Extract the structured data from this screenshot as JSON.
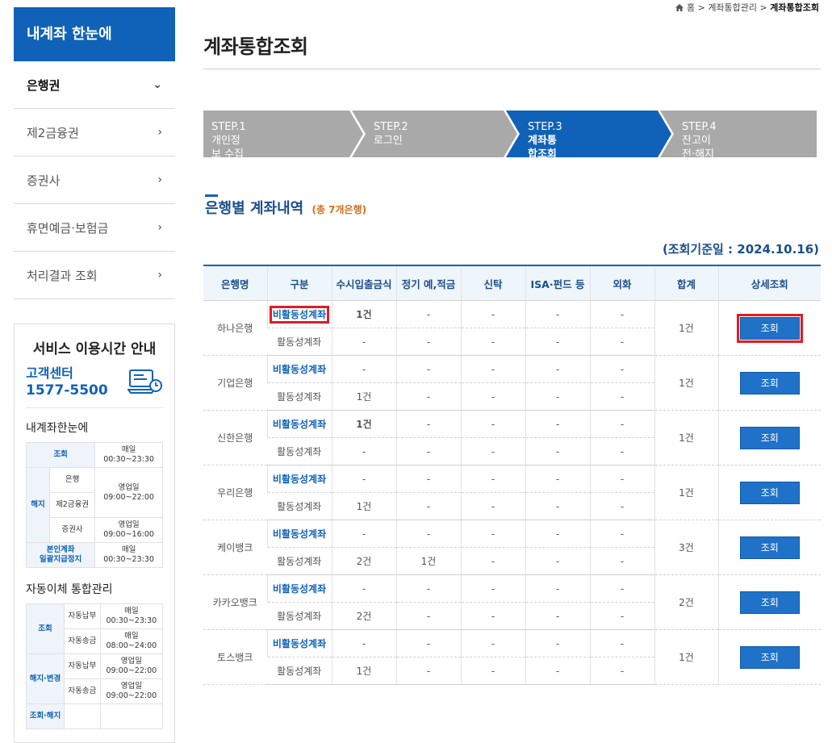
{
  "sidebar": {
    "header": "내계좌 한눈에",
    "items": [
      {
        "label": "은행권",
        "chevron": "⌄"
      },
      {
        "label": "제2금융권",
        "chevron": "›"
      },
      {
        "label": "증권사",
        "chevron": "›"
      },
      {
        "label": "휴면예금·보험금",
        "chevron": "›"
      },
      {
        "label": "처리결과 조회",
        "chevron": "›"
      }
    ]
  },
  "service": {
    "title": "서비스 이용시간 안내",
    "cc_label": "고객센터",
    "cc_number": "1577-5500",
    "sec1_title": "내계좌한눈에",
    "sec1": {
      "r1_head": "조회",
      "r1_time": "매일\n00:30~23:30",
      "r2_head": "해지",
      "r2_sub": "은행",
      "r2_time": "영업일\n09:00~22:00",
      "r3_sub": "제2금융권",
      "r4_sub": "증권사",
      "r4_time": "영업일\n09:00~16:00",
      "r5_head": "본인계좌\n일괄지급정지",
      "r5_time": "매일\n00:30~23:30"
    },
    "sec2_title": "자동이체 통합관리",
    "sec2": {
      "r1_head": "조회",
      "r1_sub": "자동납부",
      "r1_time": "매일\n00:30~23:30",
      "r2_sub": "자동송금",
      "r2_time": "매일\n08:00~24:00",
      "r3_head": "해지·변경",
      "r3_sub": "자동납부",
      "r3_time": "영업일\n09:00~22:00",
      "r4_sub": "자동송금",
      "r4_time": "영업일\n09:00~22:00",
      "r5_head": "조회·해지"
    }
  },
  "breadcrumb": {
    "home": "홈",
    "sep": ">",
    "level1": "계좌통합관리",
    "level2": "계좌통합조회"
  },
  "page_title": "계좌통합조회",
  "steps": [
    {
      "num": "STEP.1",
      "label": "개인정보 수집 및 이용동의"
    },
    {
      "num": "STEP.2",
      "label": "로그인"
    },
    {
      "num": "STEP.3",
      "label": "계좌통합조회"
    },
    {
      "num": "STEP.4",
      "label": "잔고이전·해지"
    }
  ],
  "section": {
    "title": "은행별 계좌내역",
    "count": "(총 7개은행)",
    "base_date": "(조회기준일 : 2024.10.16)"
  },
  "table": {
    "headers": [
      "은행명",
      "구분",
      "수시입출금식",
      "정기 예,적금",
      "신탁",
      "ISA·펀드 등",
      "외화",
      "합계",
      "상세조회"
    ],
    "rows": [
      {
        "bank": "하나은행",
        "type_top": "비활동성계좌",
        "type_bot": "활동성계좌",
        "top": [
          "1건",
          "-",
          "-",
          "-",
          "-"
        ],
        "bot": [
          "-",
          "-",
          "-",
          "-",
          "-"
        ],
        "total": "1건",
        "btn": "조회"
      },
      {
        "bank": "기업은행",
        "type_top": "비활동성계좌",
        "type_bot": "활동성계좌",
        "top": [
          "-",
          "-",
          "-",
          "-",
          "-"
        ],
        "bot": [
          "1건",
          "-",
          "-",
          "-",
          "-"
        ],
        "total": "1건",
        "btn": "조회"
      },
      {
        "bank": "신한은행",
        "type_top": "비활동성계좌",
        "type_bot": "활동성계좌",
        "top": [
          "1건",
          "-",
          "-",
          "-",
          "-"
        ],
        "bot": [
          "-",
          "-",
          "-",
          "-",
          "-"
        ],
        "total": "1건",
        "btn": "조회"
      },
      {
        "bank": "우리은행",
        "type_top": "비활동성계좌",
        "type_bot": "활동성계좌",
        "top": [
          "-",
          "-",
          "-",
          "-",
          "-"
        ],
        "bot": [
          "1건",
          "-",
          "-",
          "-",
          "-"
        ],
        "total": "1건",
        "btn": "조회"
      },
      {
        "bank": "케이뱅크",
        "type_top": "비활동성계좌",
        "type_bot": "활동성계좌",
        "top": [
          "-",
          "-",
          "-",
          "-",
          "-"
        ],
        "bot": [
          "2건",
          "1건",
          "-",
          "-",
          "-"
        ],
        "total": "3건",
        "btn": "조회"
      },
      {
        "bank": "카카오뱅크",
        "type_top": "비활동성계좌",
        "type_bot": "활동성계좌",
        "top": [
          "-",
          "-",
          "-",
          "-",
          "-"
        ],
        "bot": [
          "2건",
          "-",
          "-",
          "-",
          "-"
        ],
        "total": "2건",
        "btn": "조회"
      },
      {
        "bank": "토스뱅크",
        "type_top": "비활동성계좌",
        "type_bot": "활동성계좌",
        "top": [
          "-",
          "-",
          "-",
          "-",
          "-"
        ],
        "bot": [
          "1건",
          "-",
          "-",
          "-",
          "-"
        ],
        "total": "1건",
        "btn": "조회"
      }
    ]
  },
  "colors": {
    "primary": "#1062b8",
    "step_inactive": "#a9a9a9",
    "highlight": "#e01c24",
    "count": "#d5701d"
  }
}
